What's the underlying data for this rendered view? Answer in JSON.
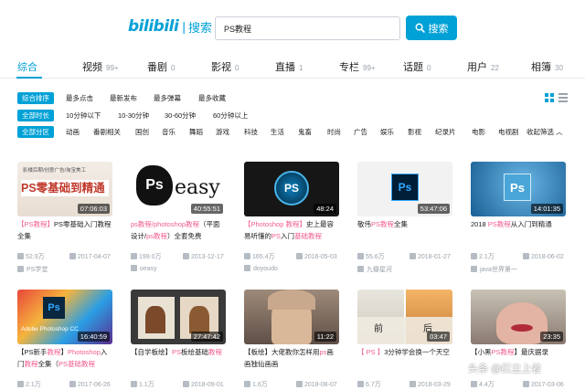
{
  "header": {
    "logo_text": "bilibili",
    "logo_sep": "|",
    "logo_sub": "搜索",
    "search_value": "PS教程",
    "search_button": "搜索"
  },
  "tabs": [
    {
      "label": "综合",
      "count": "",
      "active": true
    },
    {
      "label": "视频",
      "count": "99+"
    },
    {
      "label": "番剧",
      "count": "0"
    },
    {
      "label": "影视",
      "count": "0"
    },
    {
      "label": "直播",
      "count": "1"
    },
    {
      "label": "专栏",
      "count": "99+"
    },
    {
      "label": "话题",
      "count": "0"
    },
    {
      "label": "用户",
      "count": "22"
    },
    {
      "label": "相簿",
      "count": "30"
    }
  ],
  "filters": {
    "sort": {
      "label": "综合排序",
      "options": [
        "最多点击",
        "最新发布",
        "最多弹幕",
        "最多收藏"
      ]
    },
    "duration": {
      "label": "全部时长",
      "options": [
        "10分钟以下",
        "10-30分钟",
        "30-60分钟",
        "60分钟以上"
      ]
    },
    "zone": {
      "label": "全部分区",
      "options": [
        "动画",
        "番剧相关",
        "国创",
        "音乐",
        "舞蹈",
        "游戏",
        "科技",
        "生活",
        "鬼畜",
        "时尚",
        "广告",
        "娱乐",
        "影视",
        "纪录片",
        "电影",
        "电视剧"
      ],
      "collapse": "收起筛选"
    }
  },
  "videos": [
    {
      "duration": "07:06:03",
      "title": [
        [
          "【PS教程】",
          "hl"
        ],
        [
          "PS零基础入门教程全集",
          ""
        ]
      ],
      "views": "52.9万",
      "date": "2017-04-07",
      "uploader": "PS学堂",
      "thumb_text": "PS零基础到精通",
      "thumb_sub": "影楼后期/创意广告/淘宝美工"
    },
    {
      "duration": "40:55:51",
      "title": [
        [
          "ps教程/photoshop教程",
          "hl"
        ],
        [
          "（平面设计/",
          ""
        ],
        [
          "ps教程",
          "hl"
        ],
        [
          "）全套免费",
          ""
        ]
      ],
      "views": "199.0万",
      "date": "2013-12-17",
      "uploader": "oeasy",
      "thumb_text": "easy"
    },
    {
      "duration": "48:24",
      "title": [
        [
          "【Photoshop 教程】",
          "hl"
        ],
        [
          "史上最容易听懂的",
          ""
        ],
        [
          "PS",
          "hl"
        ],
        [
          "入门",
          ""
        ],
        [
          "基础教程",
          "hl"
        ]
      ],
      "views": "165.4万",
      "date": "2016-05-03",
      "uploader": "doyoudo",
      "thumb_text": "PS"
    },
    {
      "duration": "53:47:06",
      "title": [
        [
          "敬伟",
          ""
        ],
        [
          "PS教程",
          "hl"
        ],
        [
          "全集",
          ""
        ]
      ],
      "views": "55.6万",
      "date": "2018-01-27",
      "uploader": "九瓣星河",
      "thumb_text": "Ps"
    },
    {
      "duration": "14:01:35",
      "title": [
        [
          "2018 ",
          ""
        ],
        [
          "PS教程",
          "hl"
        ],
        [
          "从入门到精通",
          ""
        ]
      ],
      "views": "2.1万",
      "date": "2018-06-02",
      "uploader": "java世界第一",
      "thumb_text": "Ps"
    },
    {
      "duration": "16:40:59",
      "title": [
        [
          "【PS新手",
          ""
        ],
        [
          "教程",
          "hl"
        ],
        [
          "】",
          ""
        ],
        [
          "Photoshop",
          "hl"
        ],
        [
          "入门",
          ""
        ],
        [
          "教程",
          "hl"
        ],
        [
          "全集（",
          ""
        ],
        [
          "PS基础教程",
          "hl"
        ]
      ],
      "views": "2.1万",
      "date": "2017-06-26",
      "uploader": "",
      "thumb_text": "Ps",
      "thumb_sub": "Adobe Photoshop CC"
    },
    {
      "duration": "27:47:42",
      "title": [
        [
          "【自学板绘】",
          ""
        ],
        [
          "PS",
          "hl"
        ],
        [
          "板绘基础",
          ""
        ],
        [
          "教程",
          "hl"
        ]
      ],
      "views": "1.1万",
      "date": "2018-09-01",
      "uploader": ""
    },
    {
      "duration": "11:22",
      "title": [
        [
          "【板绘】",
          ""
        ],
        [
          "大佬教你怎样用",
          ""
        ],
        [
          "ps",
          "hl"
        ],
        [
          "画画独仙画画",
          ""
        ]
      ],
      "views": "1.6万",
      "date": "2018-08-07",
      "uploader": ""
    },
    {
      "duration": "03:47",
      "title": [
        [
          "【 PS 】",
          "hl"
        ],
        [
          "3分钟学会换一个天空",
          ""
        ]
      ],
      "views": "6.7万",
      "date": "2018-03-29",
      "uploader": "",
      "thumb_text": "前",
      "thumb_sub": "后"
    },
    {
      "duration": "23:35",
      "title": [
        [
          "【小黑",
          ""
        ],
        [
          "PS教程",
          "hl"
        ],
        [
          "】",
          ""
        ],
        [
          "最庆据录",
          ""
        ]
      ],
      "views": "4.4万",
      "date": "2017-03-06",
      "uploader": ""
    }
  ],
  "watermark": "头条 @红尘上者",
  "colors": {
    "accent": "#00a1d6",
    "highlight": "#f25d8e",
    "muted": "#99a2aa"
  }
}
